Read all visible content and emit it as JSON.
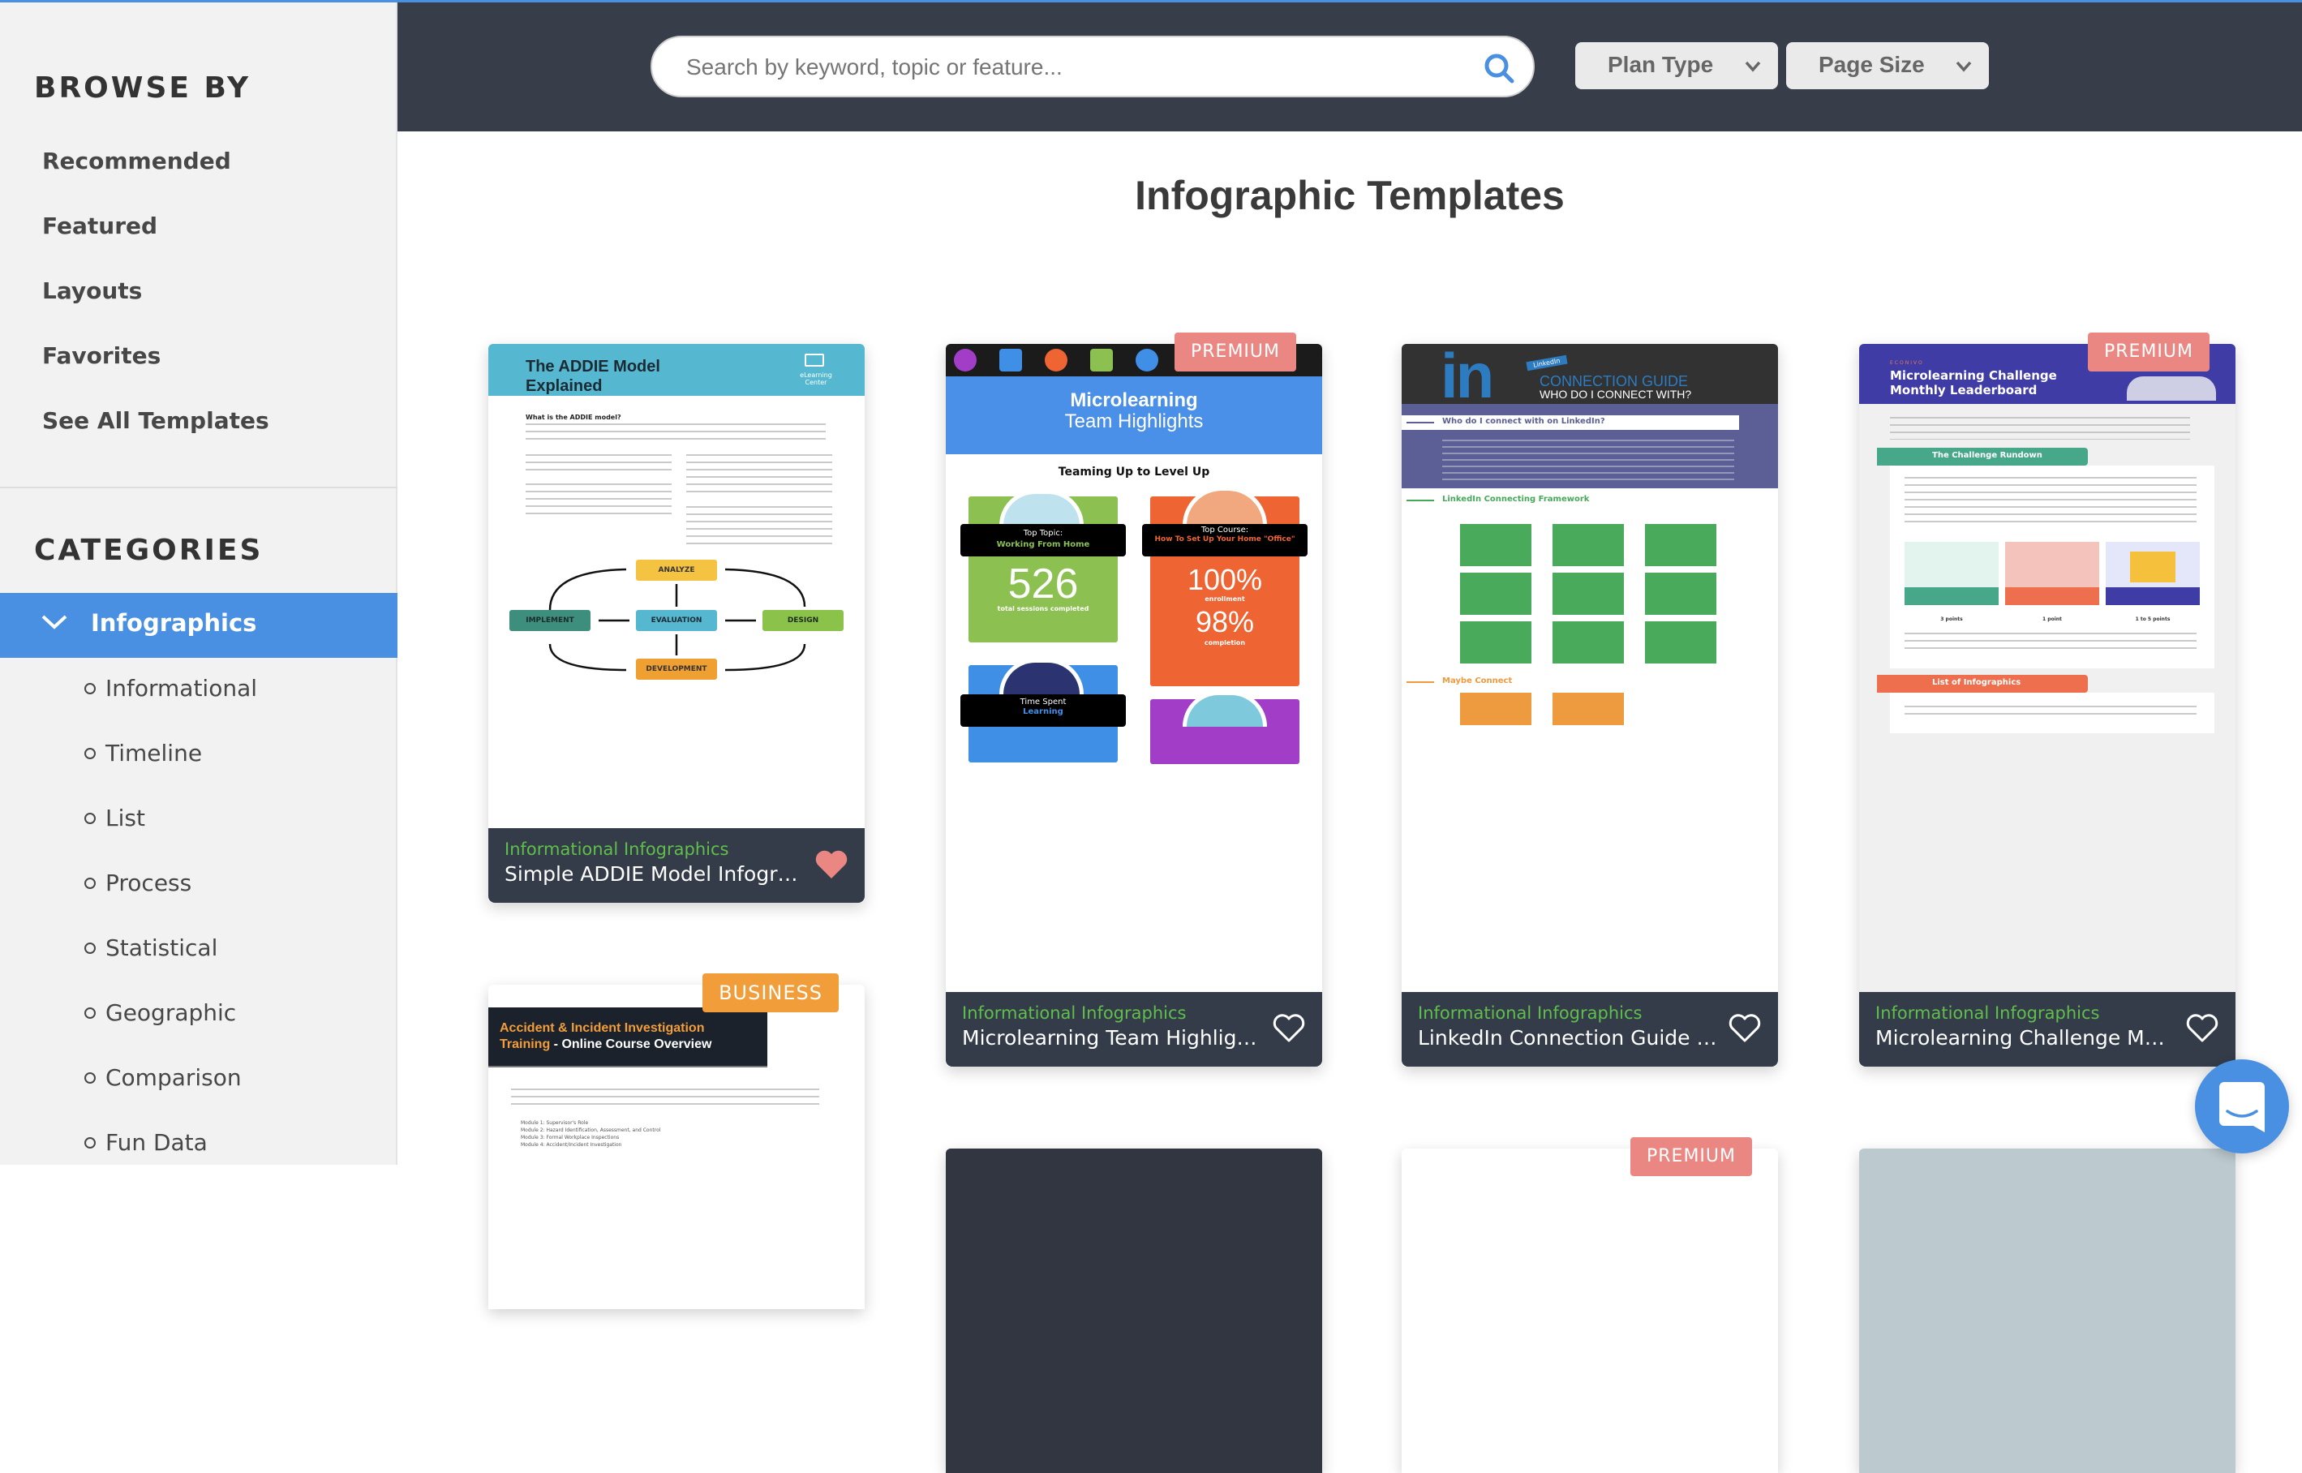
{
  "sidebar": {
    "browse_heading": "BROWSE BY",
    "browse_items": [
      "Recommended",
      "Featured",
      "Layouts",
      "Favorites",
      "See All Templates"
    ],
    "categories_heading": "CATEGORIES",
    "active_category": "Infographics",
    "sub_categories": [
      "Informational",
      "Timeline",
      "List",
      "Process",
      "Statistical",
      "Geographic",
      "Comparison",
      "Fun Data"
    ]
  },
  "header": {
    "search_placeholder": "Search by keyword, topic or feature...",
    "search_value": "",
    "plan_type_label": "Plan Type",
    "page_size_label": "Page Size"
  },
  "main": {
    "title": "Infographic Templates",
    "cards": [
      {
        "category": "Informational Infographics",
        "name": "Simple ADDIE Model Infographic",
        "badge": "",
        "favorited": true,
        "thumb": {
          "title_line1": "The ADDIE Model",
          "title_line2": "Explained",
          "logo": "eLearning Center",
          "question": "What is the ADDIE model?",
          "steps": [
            "ANALYZE",
            "IMPLEMENT",
            "EVALUATION",
            "DESIGN",
            "DEVELOPMENT"
          ]
        }
      },
      {
        "category": "Informational Infographics",
        "name": "Microlearning Team Highlights I...",
        "badge": "PREMIUM",
        "favorited": false,
        "thumb": {
          "title_line1": "Microlearning",
          "title_line2": "Team Highlights",
          "section": "Teaming Up to Level Up",
          "topic_label": "Top Topic:",
          "topic_value": "Working From Home",
          "course_label": "Top Course:",
          "course_value": "How To Set Up Your Home \"Office\"",
          "sessions": "526",
          "sessions_label": "total sessions completed",
          "enrollment": "100%",
          "enrollment_label": "enrollment",
          "completion": "98%",
          "completion_label": "completion",
          "time_label": "Time Spent",
          "time_value": "Learning"
        }
      },
      {
        "category": "Informational Infographics",
        "name": "LinkedIn Connection Guide Info...",
        "badge": "",
        "favorited": false,
        "thumb": {
          "logo": "in",
          "tag": "LinkedIn",
          "title_line1": "CONNECTION GUIDE",
          "title_line2": "WHO DO I CONNECT WITH?",
          "question": "Who do I connect with on LinkedIn?",
          "framework": "LinkedIn Connecting Framework",
          "maybe": "Maybe Connect"
        }
      },
      {
        "category": "Informational Infographics",
        "name": "Microlearning Challenge Month...",
        "badge": "PREMIUM",
        "favorited": false,
        "thumb": {
          "brand": "ECONIVO",
          "title_line1": "Microlearning Challenge",
          "title_line2": "Monthly Leaderboard",
          "section1": "The Challenge Rundown",
          "section2": "List of Infographics",
          "points": [
            "3 points",
            "1 point",
            "1 to 5 points"
          ]
        }
      }
    ],
    "row2_cards": [
      {
        "badge": "BUSINESS",
        "thumb": {
          "title_orange": "Accident & Incident Investigation",
          "title_orange2": "Training",
          "title_white": " - Online Course Overview",
          "modules": [
            "Module 1: Supervisor's Role",
            "Module 2: Hazard Identification, Assessment, and Control",
            "Module 3: Formal Workplace Inspections",
            "Module 4: Accident/Incident Investigation"
          ]
        }
      },
      {
        "badge": ""
      },
      {
        "badge": "PREMIUM"
      },
      {
        "badge": ""
      }
    ]
  },
  "colors": {
    "accent": "#4a90e2",
    "header_bg": "#373d49",
    "card_footer_bg": "#343c4a",
    "category_green": "#5fbf4a",
    "premium": "#ea8782",
    "business": "#f09d3a",
    "heart_active": "#ea8782"
  }
}
